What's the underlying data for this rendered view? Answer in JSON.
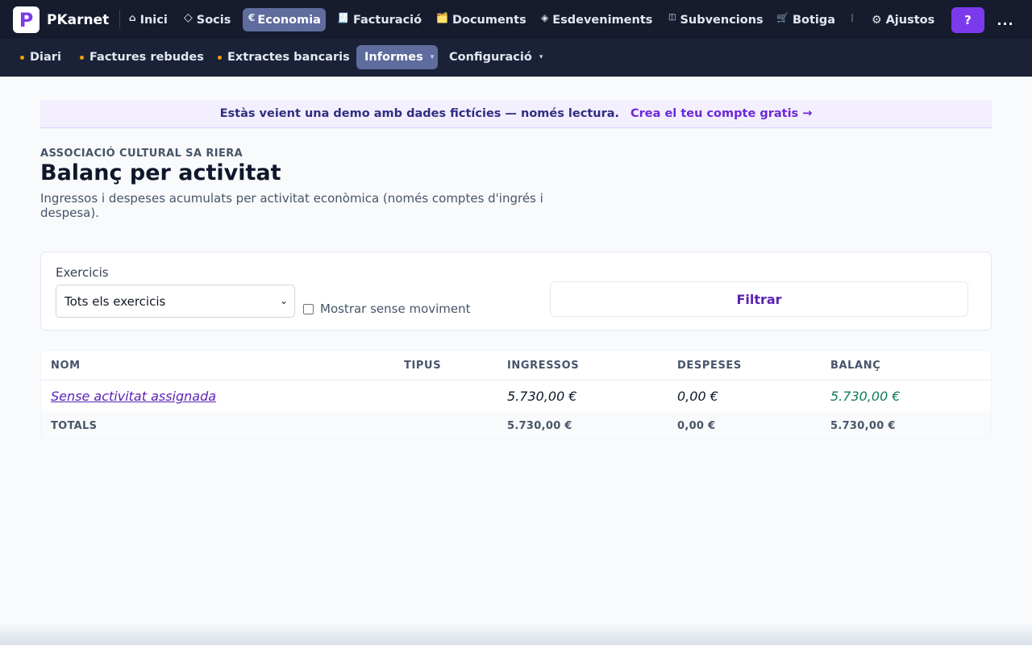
{
  "app": {
    "name": "PKarnet",
    "logo_letter": "P"
  },
  "nav": {
    "items": [
      {
        "icon": "⌂",
        "label": "Inici"
      },
      {
        "icon": "◇",
        "label": "Socis"
      },
      {
        "icon": "€",
        "label": "Economia"
      },
      {
        "icon": "🧾",
        "label": "Facturació"
      },
      {
        "icon": "🗂️",
        "label": "Documents"
      },
      {
        "icon": "◈",
        "label": "Esdeveniments"
      },
      {
        "icon": "◫",
        "label": "Subvencions"
      },
      {
        "icon": "🛒",
        "label": "Botiga"
      }
    ],
    "settings": {
      "icon": "⚙",
      "label": "Ajustos"
    },
    "help_label": "?",
    "more_label": "..."
  },
  "subnav": {
    "items": [
      {
        "label": "Diari"
      },
      {
        "label": "Factures rebudes"
      },
      {
        "label": "Extractes bancaris"
      },
      {
        "label": "Informes"
      },
      {
        "label": "Configuració"
      }
    ]
  },
  "banner": {
    "text": "Estàs veient una demo amb dades fictícies — només lectura.",
    "link": "Crea el teu compte gratis →"
  },
  "page": {
    "org": "ASSOCIACIÓ CULTURAL SA RIERA",
    "title": "Balanç per activitat",
    "description": "Ingressos i despeses acumulats per activitat econòmica (només comptes d'ingrés i despesa)."
  },
  "filters": {
    "label": "Exercicis",
    "selected": "Tots els exercicis",
    "checkbox_label": "Mostrar sense moviment",
    "checkbox_checked": false,
    "button": "Filtrar"
  },
  "table": {
    "columns": [
      "NOM",
      "TIPUS",
      "INGRESSOS",
      "DESPESES",
      "BALANÇ"
    ],
    "rows": [
      {
        "nom": "Sense activitat assignada",
        "tipus": "",
        "ingressos": "5.730,00 €",
        "despeses": "0,00 €",
        "balanc": "5.730,00 €"
      }
    ],
    "totals": {
      "label": "TOTALS",
      "ingressos": "5.730,00 €",
      "despeses": "0,00 €",
      "balanc": "5.730,00 €"
    }
  },
  "colors": {
    "nav_bg": "#161c2e",
    "accent": "#7c3aed",
    "positive": "#0f7a5a",
    "active_pill": "#5f6c9e"
  }
}
